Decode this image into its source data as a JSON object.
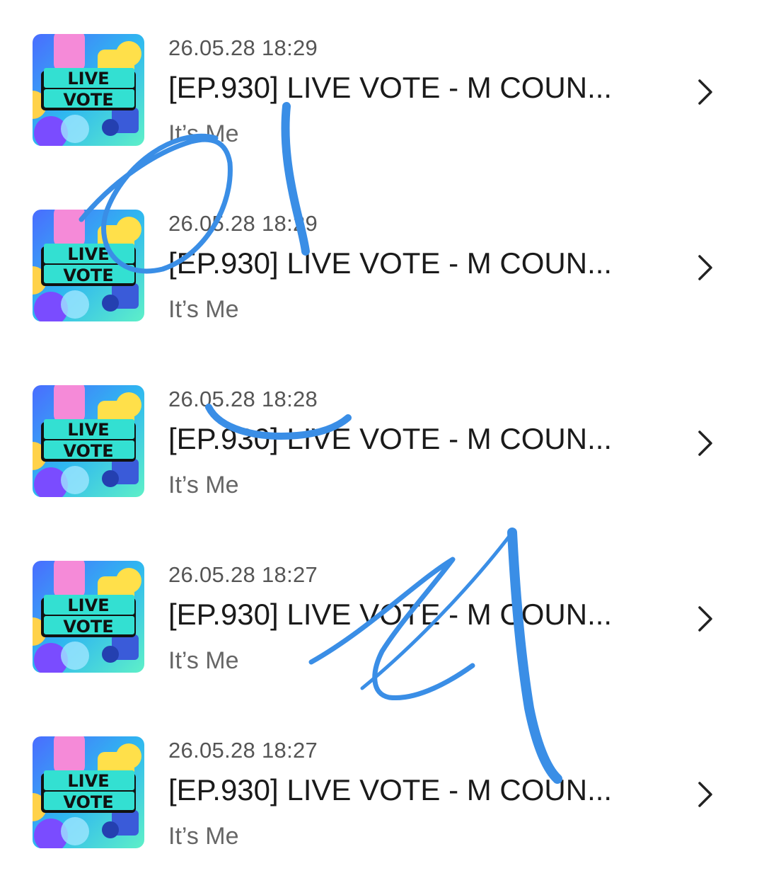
{
  "items": [
    {
      "date": "26.05.28 18:29",
      "title": "[EP.930] LIVE VOTE - M COUN...",
      "artist": "It’s Me",
      "thumb_line1": "LIVE",
      "thumb_line2": "VOTE",
      "chevron_icon": "chevron-right-icon"
    },
    {
      "date": "26.05.28 18:29",
      "title": "[EP.930] LIVE VOTE - M COUN...",
      "artist": "It’s Me",
      "thumb_line1": "LIVE",
      "thumb_line2": "VOTE",
      "chevron_icon": "chevron-right-icon"
    },
    {
      "date": "26.05.28 18:28",
      "title": "[EP.930] LIVE VOTE - M COUN...",
      "artist": "It’s Me",
      "thumb_line1": "LIVE",
      "thumb_line2": "VOTE",
      "chevron_icon": "chevron-right-icon"
    },
    {
      "date": "26.05.28 18:27",
      "title": "[EP.930] LIVE VOTE - M COUN...",
      "artist": "It’s Me",
      "thumb_line1": "LIVE",
      "thumb_line2": "VOTE",
      "chevron_icon": "chevron-right-icon"
    },
    {
      "date": "26.05.28 18:27",
      "title": "[EP.930] LIVE VOTE - M COUN...",
      "artist": "It’s Me",
      "thumb_line1": "LIVE",
      "thumb_line2": "VOTE",
      "chevron_icon": "chevron-right-icon"
    }
  ],
  "colors": {
    "annotation": "#3a8ee6",
    "badge": "#33e0d2",
    "title": "#1a1a1a",
    "meta": "#555555"
  }
}
